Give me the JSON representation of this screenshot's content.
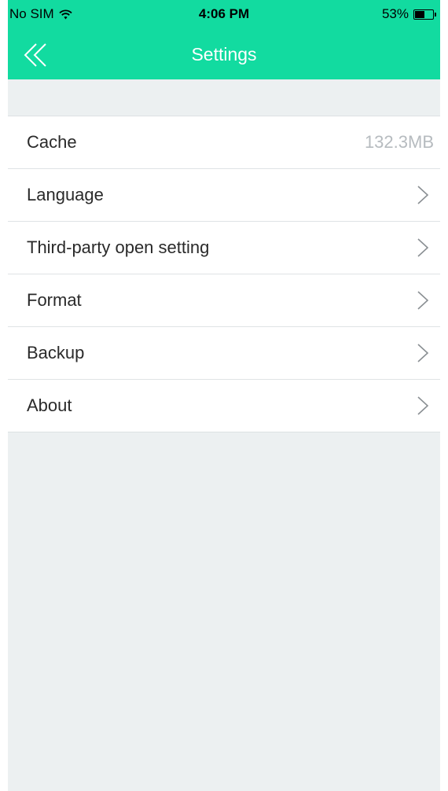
{
  "status": {
    "carrier": "No SIM",
    "time": "4:06 PM",
    "battery_percent": "53%",
    "battery_level": 0.53
  },
  "nav": {
    "title": "Settings",
    "back_icon": "double-chevron-left-icon"
  },
  "colors": {
    "header": "#12dba0",
    "background": "#ecf0f1",
    "label": "#2a2a2a",
    "value": "#b6bbbf"
  },
  "rows": [
    {
      "label": "Cache",
      "value": "132.3MB"
    },
    {
      "label": "Language"
    },
    {
      "label": "Third-party open setting"
    },
    {
      "label": "Format"
    },
    {
      "label": "Backup"
    },
    {
      "label": "About"
    }
  ]
}
